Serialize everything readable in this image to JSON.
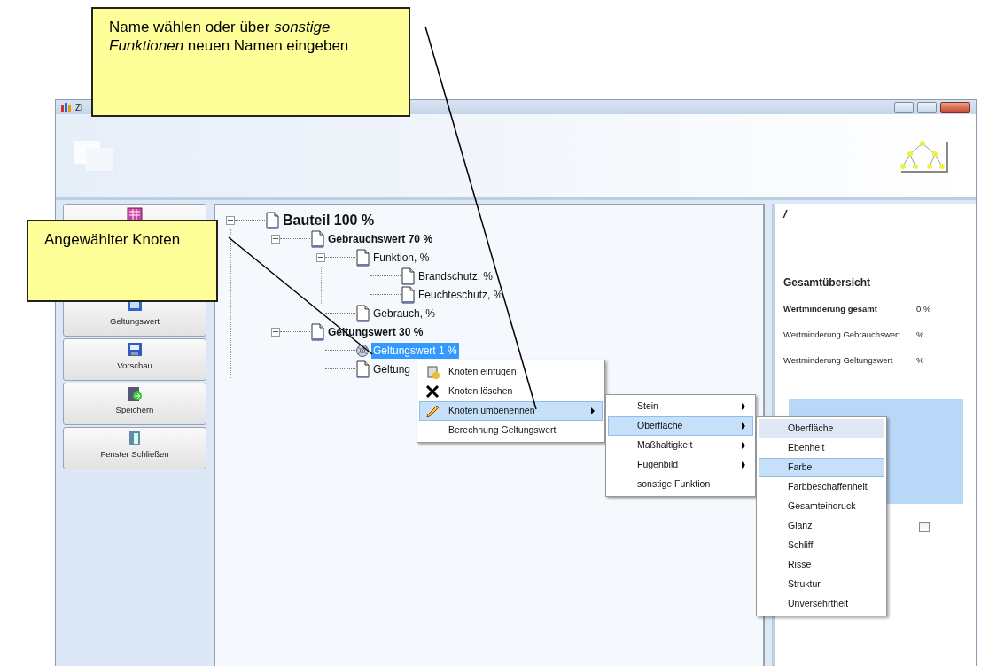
{
  "window": {
    "title": "Zi"
  },
  "sidebar": {
    "buttons": [
      {
        "kind": "icon_only"
      },
      {
        "kind": "labeled",
        "label": "Geltungswert"
      },
      {
        "kind": "labeled",
        "label": "Vorschau"
      },
      {
        "kind": "labeled",
        "label": "Speichern"
      },
      {
        "kind": "labeled",
        "label": "Fenster Schließen"
      }
    ]
  },
  "tree": {
    "nodes": [
      {
        "label": "Bauteil 100 %",
        "kind": "root",
        "expanded": true,
        "selected": false,
        "children": [
          {
            "label": "Gebrauchswert  70 %",
            "kind": "group",
            "expanded": true,
            "selected": false,
            "children": [
              {
                "label": "Funktion,  %",
                "kind": "item",
                "expanded": true,
                "selected": false,
                "children": [
                  {
                    "label": "Brandschutz,  %",
                    "kind": "item",
                    "selected": false
                  },
                  {
                    "label": "Feuchteschutz,  %",
                    "kind": "item",
                    "selected": false
                  }
                ]
              },
              {
                "label": "Gebrauch,  %",
                "kind": "item",
                "selected": false
              }
            ]
          },
          {
            "label": "Geltungswert  30 %",
            "kind": "group",
            "expanded": true,
            "selected": false,
            "children": [
              {
                "label": "Geltungswert  1  %",
                "kind": "item",
                "selected": true
              },
              {
                "label": "Geltung",
                "kind": "item",
                "selected": false
              }
            ]
          }
        ]
      }
    ]
  },
  "overview": {
    "marker": "/",
    "title": "Gesamtübersicht",
    "rows": [
      {
        "label": "Wertminderung gesamt",
        "value": "0 %",
        "bold": true
      },
      {
        "label": "Wertminderung Gebrauchswert",
        "value": "%",
        "bold": false
      },
      {
        "label": "Wertminderung Geltungswert",
        "value": "%",
        "bold": false
      }
    ],
    "checkbox": {
      "checked": false
    }
  },
  "context_menu": {
    "items": [
      {
        "label": "Knoten einfügen",
        "kind": "action",
        "selected": false
      },
      {
        "label": "Knoten löschen",
        "kind": "action",
        "selected": false
      },
      {
        "label": "Knoten umbenennen",
        "kind": "submenu",
        "selected": true
      },
      {
        "label": "Berechnung Geltungswert",
        "kind": "action",
        "selected": false
      }
    ]
  },
  "submenu": {
    "items": [
      {
        "label": "Stein",
        "kind": "submenu",
        "selected": false
      },
      {
        "label": "Oberfläche",
        "kind": "submenu",
        "selected": true
      },
      {
        "label": "Maßhaltigkeit",
        "kind": "submenu",
        "selected": false
      },
      {
        "label": "Fugenbild",
        "kind": "submenu",
        "selected": false
      },
      {
        "label": "sonstige Funktion",
        "kind": "action",
        "selected": false
      }
    ]
  },
  "submenu_2": {
    "items": [
      {
        "label": "Oberfläche",
        "selected": false,
        "hovered": true
      },
      {
        "label": "Ebenheit",
        "selected": false,
        "hovered": false
      },
      {
        "label": "Farbe",
        "selected": true,
        "hovered": false
      },
      {
        "label": "Farbbeschaffenheit",
        "selected": false,
        "hovered": false
      },
      {
        "label": "Gesamteindruck",
        "selected": false,
        "hovered": false
      },
      {
        "label": "Glanz",
        "selected": false,
        "hovered": false
      },
      {
        "label": "Schliff",
        "selected": false,
        "hovered": false
      },
      {
        "label": "Risse",
        "selected": false,
        "hovered": false
      },
      {
        "label": "Struktur",
        "selected": false,
        "hovered": false
      },
      {
        "label": "Unversehrtheit",
        "selected": false,
        "hovered": false
      }
    ]
  },
  "annotations": [
    {
      "text": "Name wählen oder über *sonstige Funktionen* neuen Namen eingeben"
    },
    {
      "text": "Angewählter Knoten"
    }
  ]
}
